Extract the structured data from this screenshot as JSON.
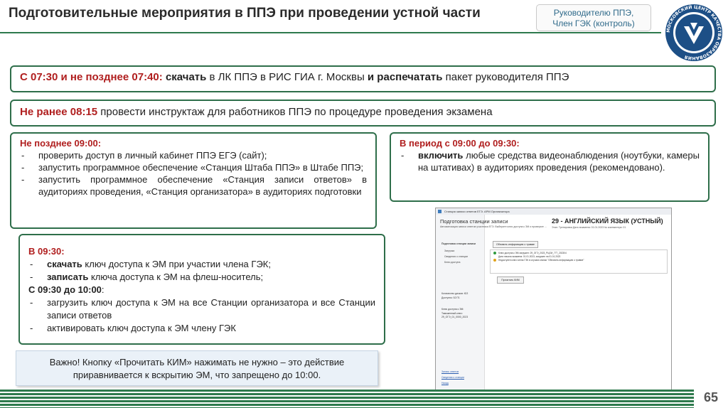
{
  "header": {
    "title": "Подготовительные мероприятия в ППЭ при проведении устной части",
    "role_line1": "Руководителю ППЭ,",
    "role_line2": "Член ГЭК (контроль)"
  },
  "step1": {
    "time": "С 07:30 и не позднее 07:40:",
    "a1": "скачать",
    "t1": "в ЛК ППЭ в РИС ГИА г. Москвы",
    "a2": "и распечатать",
    "t2": "пакет руководителя ППЭ"
  },
  "step2": {
    "time": "Не ранее 08:15",
    "text": "провести инструктаж для работников ППЭ по процедуре проведения экзамена"
  },
  "step3": {
    "head": "Не позднее 09:00:",
    "items": [
      "проверить доступ в личный кабинет ППЭ ЕГЭ (сайт);",
      "запустить программное обеспечение «Станция Штаба ППЭ» в Штабе ППЭ;",
      "запустить программное обеспечение «Станция записи ответов» в аудиториях проведения, «Станция организатора» в аудиториях подготовки"
    ]
  },
  "step4": {
    "head": "В период с 09:00 до 09:30:",
    "action": "включить",
    "text": "любые средства видеонаблюдения (ноутбуки, камеры на штативах) в аудиториях проведения (рекомендовано)."
  },
  "step5": {
    "head1": "В 09:30:",
    "items1": [
      {
        "action": "скачать",
        "text": "ключ доступа к ЭМ при участии члена ГЭК;"
      },
      {
        "action": "записать",
        "text": "ключа доступа к ЭМ на флеш-носитель;"
      }
    ],
    "head2": "С 09:30 до 10:00",
    "head2_suffix": ":",
    "items2": [
      "загрузить ключ доступа к ЭМ на все Станции организатора и все Станции записи ответов",
      "активировать ключ доступа к ЭМ члену ГЭК"
    ]
  },
  "note": {
    "line1": "Важно! Кнопку «Прочитать КИМ» нажимать не нужно – это действие",
    "line2": "приравнивается к вскрытию ЭМ, что запрещено до 10:00."
  },
  "page_number": "65",
  "logo": {
    "text": "МОСКОВСКИЙ ЦЕНТР КАЧЕСТВА ОБРАЗОВАНИЯ"
  },
  "screenshot": {
    "window_title": "Станция записи ответов ЕГЭ. АРМ Организатора",
    "heading": "Подготовка станции записи",
    "heading_sub": "Автоматизация записи ответов участника ЕГЭ. Выберите ключ доступа к ЭМ и проверьте ...",
    "exam_title": "29 - АНГЛИЙСКИЙ ЯЗЫК (УСТНЫЙ)",
    "exam_sub": "Этап: Тренировка   Дата экзамена: 01.01.2023   № компьютера: 01",
    "nav_head": "Подготовка станции записи",
    "nav_items": [
      "Загрузка",
      "Сведения о станции",
      "Ключ доступа"
    ],
    "btn_refresh": "Обновить информацию о травме",
    "msg1": "Ключ доступа к ЭМ загружен: 29_ОГЭ_2023_РЦОИ_777_202304",
    "msg2": "Дата начала экзамена: 01.01.2023, загружен на 01.01.2023",
    "msg3": "Недоступен ключ члена ГЭК в случаях кнопки \"Обновить информацию о травме\"",
    "btn_read": "Прочитать КИМ",
    "info1": "Количество дисков: ЮЗ",
    "info2": "Доступно: 52 ГБ",
    "info3": "Ключ доступа к ЭМ:",
    "info4": "Таможенный ключ: 29_ОГЭ_01_0000_2023",
    "link1": "Запись ответов",
    "link2": "Сведения о станции",
    "link3": "Назад"
  },
  "colors": {
    "accent": "#2e6e4a",
    "red": "#b01e1e",
    "note_bg": "#eaf1f8"
  }
}
